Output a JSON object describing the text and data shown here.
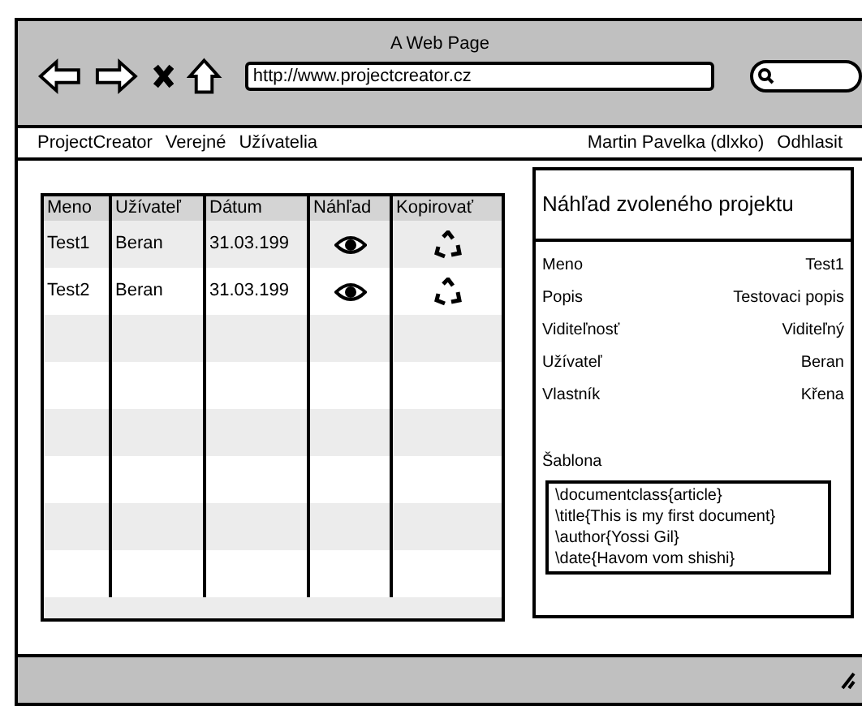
{
  "window": {
    "title": "A Web Page"
  },
  "browser": {
    "address": "http://www.projectcreator.cz"
  },
  "nav": {
    "left": [
      "ProjectCreator",
      "Verejné",
      "Užívatelia"
    ],
    "right": [
      "Martin Pavelka (dlxko)",
      "Odhlasit"
    ]
  },
  "table": {
    "columns": [
      "Meno",
      "Užívateľ",
      "Dátum",
      "Náhľad",
      "Kopirovať"
    ],
    "rows": [
      {
        "cells": [
          "Test1",
          "Beran",
          "31.03.199"
        ]
      },
      {
        "cells": [
          "Test2",
          "Beran",
          "31.03.199"
        ]
      }
    ]
  },
  "preview": {
    "title": "Náhľad zvoleného projektu",
    "fields": [
      {
        "label": "Meno",
        "value": "Test1"
      },
      {
        "label": "Popis",
        "value": "Testovaci popis"
      },
      {
        "label": "Viditeľnosť",
        "value": "Viditeľný"
      },
      {
        "label": "Užívateľ",
        "value": "Beran"
      },
      {
        "label": "Vlastník",
        "value": "Křena"
      }
    ],
    "template_label": "Šablona",
    "template_lines": [
      "\\documentclass{article}",
      "\\title{This is my first document}",
      "\\author{Yossi Gil}",
      "\\date{Havom vom shishi}"
    ]
  }
}
